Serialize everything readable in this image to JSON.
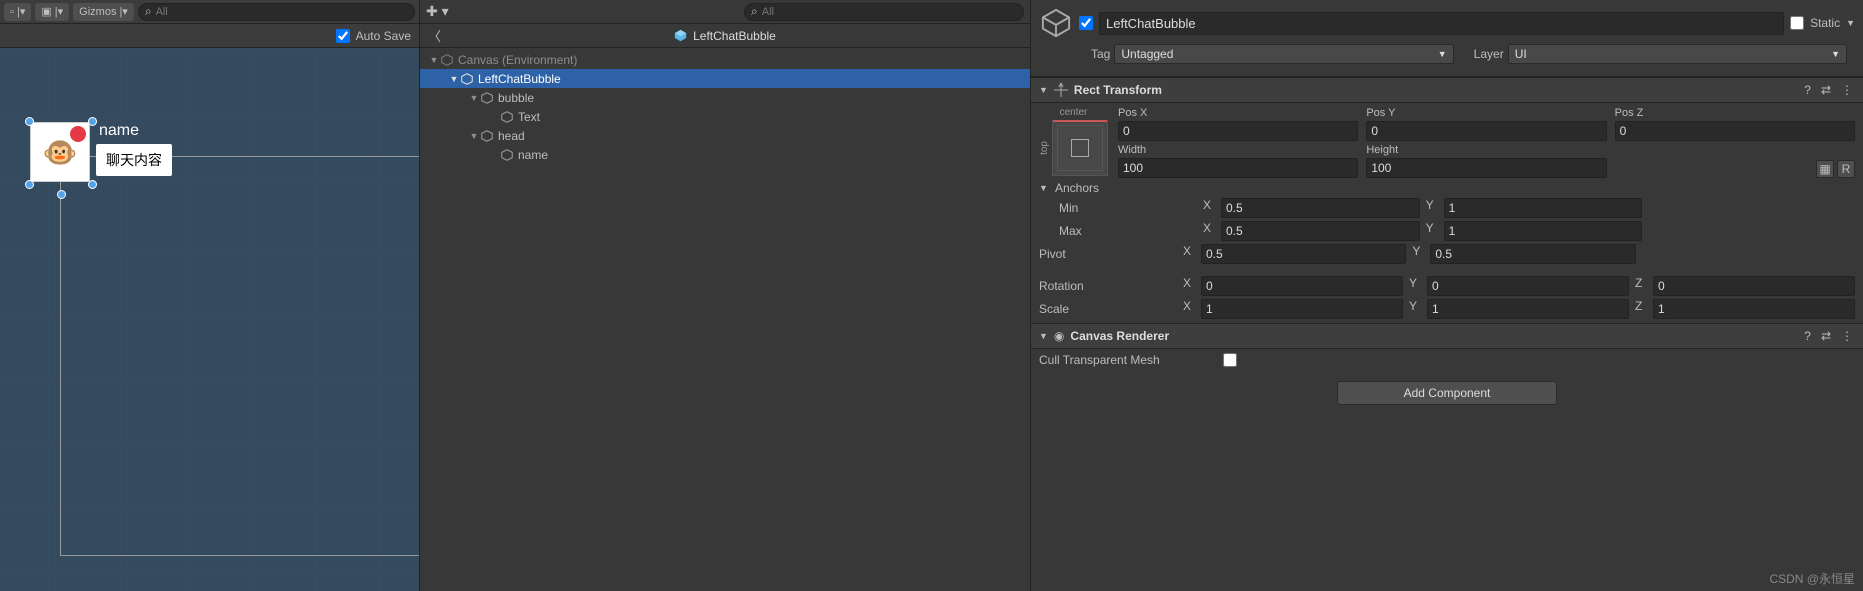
{
  "scene": {
    "gizmos_label": "Gizmos",
    "search_placeholder": "All",
    "autosave_label": "Auto Save",
    "autosave_checked": true,
    "preview": {
      "name_label": "name",
      "bubble_text": "聊天内容"
    }
  },
  "hierarchy": {
    "search_placeholder": "All",
    "header_title": "LeftChatBubble",
    "tree": [
      {
        "label": "Canvas (Environment)",
        "indent": 0,
        "arrow": "▼",
        "dim": true
      },
      {
        "label": "LeftChatBubble",
        "indent": 1,
        "arrow": "▼",
        "selected": true
      },
      {
        "label": "bubble",
        "indent": 2,
        "arrow": "▼"
      },
      {
        "label": "Text",
        "indent": 3,
        "arrow": ""
      },
      {
        "label": "head",
        "indent": 2,
        "arrow": "▼"
      },
      {
        "label": "name",
        "indent": 3,
        "arrow": ""
      }
    ]
  },
  "inspector": {
    "enabled": true,
    "name": "LeftChatBubble",
    "static_label": "Static",
    "static_checked": false,
    "tag_label": "Tag",
    "tag_value": "Untagged",
    "layer_label": "Layer",
    "layer_value": "UI",
    "rect": {
      "title": "Rect Transform",
      "anchor_h": "center",
      "anchor_v": "top",
      "posx_label": "Pos X",
      "posx": "0",
      "posy_label": "Pos Y",
      "posy": "0",
      "posz_label": "Pos Z",
      "posz": "0",
      "width_label": "Width",
      "width": "100",
      "height_label": "Height",
      "height": "100",
      "anchors_label": "Anchors",
      "min_label": "Min",
      "min_x": "0.5",
      "min_y": "1",
      "max_label": "Max",
      "max_x": "0.5",
      "max_y": "1",
      "pivot_label": "Pivot",
      "pivot_x": "0.5",
      "pivot_y": "0.5",
      "rotation_label": "Rotation",
      "rot_x": "0",
      "rot_y": "0",
      "rot_z": "0",
      "scale_label": "Scale",
      "scale_x": "1",
      "scale_y": "1",
      "scale_z": "1"
    },
    "canvas_renderer": {
      "title": "Canvas Renderer",
      "cull_label": "Cull Transparent Mesh",
      "cull_checked": false
    },
    "add_component": "Add Component"
  },
  "watermark": "CSDN @永恒星"
}
